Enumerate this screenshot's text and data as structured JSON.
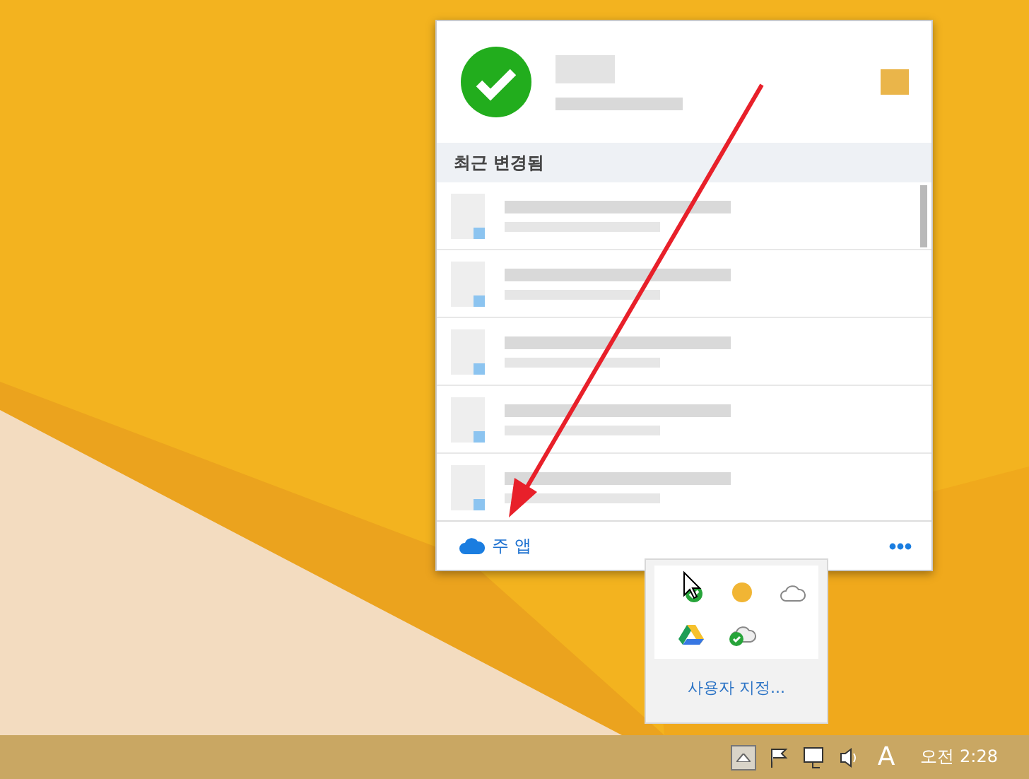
{
  "popup": {
    "section_title": "최근 변경됨",
    "files": [
      {
        "kind": "redacted"
      },
      {
        "kind": "redacted"
      },
      {
        "kind": "redacted"
      },
      {
        "kind": "redacted"
      },
      {
        "kind": "redacted"
      }
    ],
    "footer_link": "주 앱"
  },
  "tray_panel": {
    "customize_link": "사용자 지정..."
  },
  "taskbar": {
    "ime": "A",
    "clock": "오전 2:28"
  }
}
